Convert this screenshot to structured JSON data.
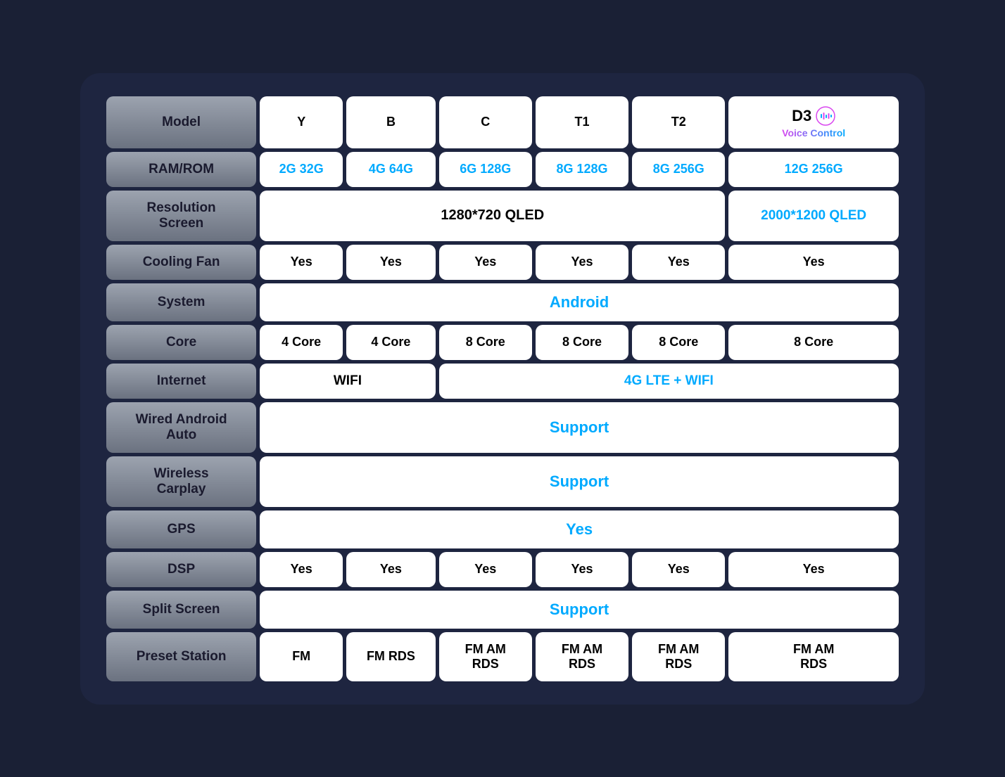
{
  "table": {
    "headers": {
      "model": "Model",
      "ram_rom": "RAM/ROM",
      "resolution": "Resolution\nScreen",
      "cooling_fan": "Cooling Fan",
      "system": "System",
      "core": "Core",
      "internet": "Internet",
      "wired_android": "Wired Android\nAuto",
      "wireless_carplay": "Wireless\nCarplay",
      "gps": "GPS",
      "dsp": "DSP",
      "split_screen": "Split Screen",
      "preset_station": "Preset Station"
    },
    "models": {
      "Y": "Y",
      "B": "B",
      "C": "C",
      "T1": "T1",
      "T2": "T2",
      "D3": "D3",
      "voice_control": "Voice Control"
    },
    "ram_rom": {
      "Y": "2G 32G",
      "B": "4G 64G",
      "C": "6G 128G",
      "T1": "8G 128G",
      "T2": "8G 256G",
      "D3": "12G 256G"
    },
    "resolution": {
      "y_to_t2": "1280*720 QLED",
      "D3": "2000*1200 QLED"
    },
    "cooling_fan": "Yes",
    "system": "Android",
    "core": {
      "Y": "4 Core",
      "B": "4 Core",
      "C": "8 Core",
      "T1": "8 Core",
      "T2": "8 Core",
      "D3": "8 Core"
    },
    "internet": {
      "Y_B": "WIFI",
      "C_to_D3": "4G LTE + WIFI"
    },
    "wired_android": "Support",
    "wireless_carplay": "Support",
    "gps": "Yes",
    "dsp": "Yes",
    "split_screen": "Support",
    "preset_station": {
      "Y": "FM",
      "B": "FM RDS",
      "C": "FM AM\nRDS",
      "T1": "FM AM\nRDS",
      "T2": "FM AM\nRDS",
      "D3": "FM AM\nRDS"
    }
  }
}
